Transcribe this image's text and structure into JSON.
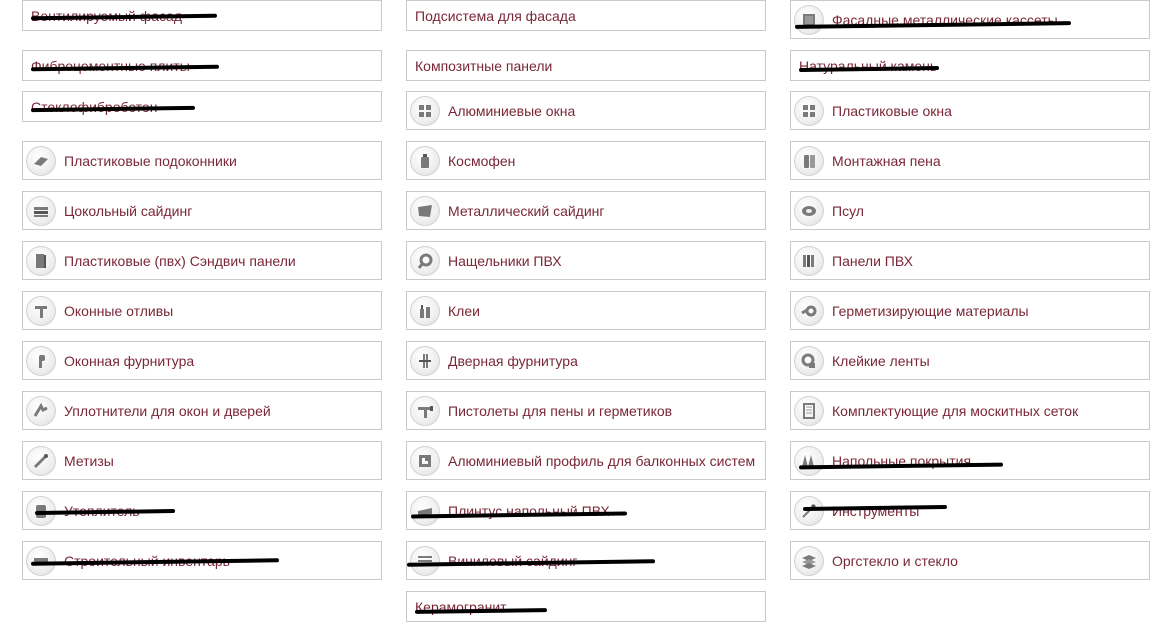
{
  "categories": [
    {
      "label": "Вентилируемый фасад",
      "icon": null
    },
    {
      "label": "Подсистема для фасада",
      "icon": null
    },
    {
      "label": "Фасадные металлические кассеты",
      "icon": "metal-cassette-icon"
    },
    {
      "label": "Фиброцементные плиты",
      "icon": null
    },
    {
      "label": "Композитные панели",
      "icon": null
    },
    {
      "label": "Натуральный камень",
      "icon": null
    },
    {
      "label": "Стеклофибробетон",
      "icon": null
    },
    {
      "label": "Алюминиевые окна",
      "icon": "window-icon"
    },
    {
      "label": "Пластиковые окна",
      "icon": "window-icon"
    },
    {
      "label": "Пластиковые подоконники",
      "icon": "windowsill-icon"
    },
    {
      "label": "Космофен",
      "icon": "glue-bottle-icon"
    },
    {
      "label": "Монтажная пена",
      "icon": "foam-can-icon"
    },
    {
      "label": "Цокольный сайдинг",
      "icon": "stone-siding-icon"
    },
    {
      "label": "Металлический сайдинг",
      "icon": "metal-sheet-icon"
    },
    {
      "label": "Псул",
      "icon": "tape-roll-icon"
    },
    {
      "label": "Пластиковые (пвх) Сэндвич панели",
      "icon": "sandwich-panel-icon"
    },
    {
      "label": "Нащельники ПВХ",
      "icon": "pvc-strip-icon"
    },
    {
      "label": "Панели ПВХ",
      "icon": "pvc-panel-icon"
    },
    {
      "label": "Оконные отливы",
      "icon": "drip-sill-icon"
    },
    {
      "label": "Клеи",
      "icon": "glue-tubes-icon"
    },
    {
      "label": "Герметизирующие материалы",
      "icon": "sealant-icon"
    },
    {
      "label": "Оконная фурнитура",
      "icon": "window-handle-icon"
    },
    {
      "label": "Дверная фурнитура",
      "icon": "door-hardware-icon"
    },
    {
      "label": "Клейкие ленты",
      "icon": "adhesive-tape-icon"
    },
    {
      "label": "Уплотнители для окон и дверей",
      "icon": "seal-profile-icon"
    },
    {
      "label": "Пистолеты для пены и герметиков",
      "icon": "foam-gun-icon"
    },
    {
      "label": "Комплектующие для москитных сеток",
      "icon": "mosquito-net-icon"
    },
    {
      "label": "Метизы",
      "icon": "screw-icon"
    },
    {
      "label": "Алюминиевый профиль для балконных систем",
      "icon": "aluminium-profile-icon"
    },
    {
      "label": "Напольные покрытия",
      "icon": "flooring-icon"
    },
    {
      "label": "Утеплитель",
      "icon": "insulation-icon"
    },
    {
      "label": "Плинтус напольный ПВХ",
      "icon": "skirting-board-icon"
    },
    {
      "label": "Инструменты",
      "icon": "tools-icon"
    },
    {
      "label": "Строительный инвентарь",
      "icon": "construction-inventory-icon"
    },
    {
      "label": "Виниловый сайдинг",
      "icon": "vinyl-siding-icon"
    },
    {
      "label": "Оргстекло и стекло",
      "icon": "glass-sheets-icon"
    },
    {
      "label": "Керамогранит",
      "icon": null
    }
  ]
}
